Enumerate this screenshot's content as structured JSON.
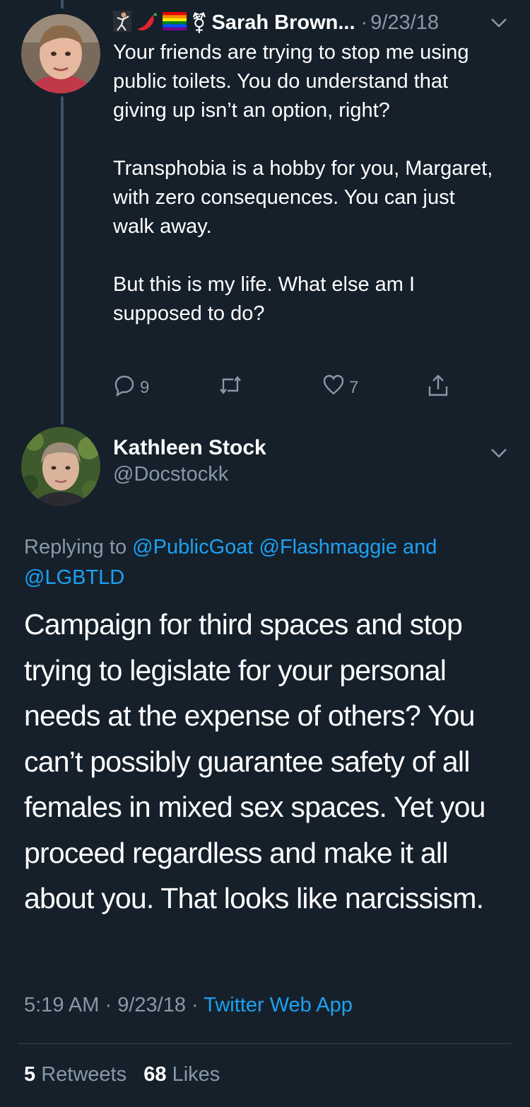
{
  "tweet1": {
    "display_name": "Sarah Brown",
    "name_ellipsis": "...",
    "separator": "·",
    "date": "9/23/18",
    "emoji_icons": [
      "dancer-icon",
      "chili-pepper-icon",
      "rainbow-flag-icon",
      "transgender-symbol-icon"
    ],
    "transgender_symbol": "⚧",
    "paragraphs": [
      "Your friends are trying to stop me using public toilets. You do understand that giving up isn’t an option, right?",
      "Transphobia is a hobby for you, Margaret, with zero consequences. You can just walk away.",
      "But this is my life. What else am I supposed to do?"
    ],
    "reply_count": "9",
    "like_count": "7"
  },
  "tweet2": {
    "display_name": "Kathleen Stock",
    "handle": "@Docstockk",
    "replying_prefix": "Replying to",
    "replying_mentions": [
      "@PublicGoat",
      "@Flashmaggie"
    ],
    "replying_and": "and",
    "replying_last": "@LGBTLD",
    "text": "Campaign for third spaces and stop trying to legislate for your personal needs at the expense of others? You can’t possibly guarantee safety of all females in mixed sex spaces. Yet you proceed regardless and make it all about you. That looks like narcissism.",
    "time": "5:19 AM",
    "separator": "·",
    "date": "9/23/18",
    "source": "Twitter Web App",
    "retweets_count": "5",
    "retweets_label": "Retweets",
    "likes_count": "68",
    "likes_label": "Likes"
  },
  "colors": {
    "background": "#15202b",
    "secondary_text": "#8899a6",
    "link": "#1da1f2",
    "thread_line": "#3d5466"
  }
}
